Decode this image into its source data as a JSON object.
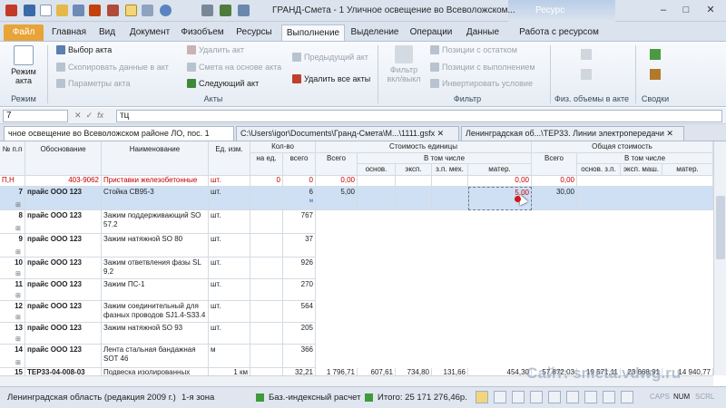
{
  "window": {
    "title": "ГРАНД-Смета - 1 Уличное освещение во Всеволожском...",
    "context_tab": "Ресурс"
  },
  "ribbon_tabs": [
    "Файл",
    "Главная",
    "Вид",
    "Документ",
    "Физобъем",
    "Ресурсы",
    "Выполнение",
    "Выделение",
    "Операции",
    "Данные",
    "Работа с ресурсом"
  ],
  "ribbon": {
    "mode_button": "Режим акта",
    "mode_group": "Режим",
    "select_act": "Выбор акта",
    "copy_data": "Скопировать данные в акт",
    "act_params": "Параметры акта",
    "delete_act": "Удалить акт",
    "smeta_based": "Смета на основе акта",
    "next_act": "Следующий акт",
    "prev_act": "Предыдущий акт",
    "delete_all": "Удалить все акты",
    "acts_group": "Акты",
    "filter_btn": "Фильтр вкл/выкл",
    "pos_remainder": "Позиции с остатком",
    "pos_completed": "Позиции с выполнением",
    "invert": "Инвертировать условие",
    "filter_group": "Фильтр",
    "phys_group": "Физ. объемы в акте",
    "summary_group": "Сводки"
  },
  "formula_bar": {
    "cell_ref": "7",
    "value": "тц"
  },
  "doc_tabs": [
    "чное освещение во Всеволожском районе ЛО, пос. 1",
    "C:\\Users\\igor\\Documents\\Гранд-Смета\\М...\\1111.gsfx",
    "Ленинградская об...\\ТЕР33. Линии электропередачи"
  ],
  "headers": {
    "num": "№ п.п",
    "basis": "Обоснование",
    "name": "Наименование",
    "unit": "Ед. изм.",
    "qty": "Кол-во",
    "qty_per_unit": "на ед.",
    "qty_total": "всего",
    "unit_cost": "Стоимость единицы",
    "total_cost": "Общая стоимость",
    "total": "Всего",
    "incl": "В том числе",
    "base_wage": "основ. з.п.",
    "mach": "эксп. маш.",
    "mach_wage": "з.п. мех.",
    "mat": "матер.",
    "base_wage2": "основ. з.п.",
    "mach2": "эксп. маш.",
    "mat2": "матер."
  },
  "rows": [
    {
      "num": "П,Н",
      "basis": "403-9062",
      "name": "Приставки железобетонные",
      "unit": "шт.",
      "per": "0",
      "total": "0",
      "c_total": "0,00",
      "mat": "0,00",
      "t_total": "0,00"
    },
    {
      "num": "7",
      "basis": "прайс ООО 123",
      "name": "Стойка СВ95-3",
      "unit": "шт.",
      "per": "",
      "total": "6",
      "sub": "м",
      "c_total": "5,00",
      "mat": "5,00",
      "t_total": "30,00"
    },
    {
      "num": "8",
      "basis": "прайс ООО 123",
      "name": "Зажим поддерживающий SO 57.2",
      "unit": "шт.",
      "total": "767"
    },
    {
      "num": "9",
      "basis": "прайс ООО 123",
      "name": "Зажим натяжной SO 80",
      "unit": "шт.",
      "total": "37"
    },
    {
      "num": "10",
      "basis": "прайс ООО 123",
      "name": "Зажим ответвления фазы SL 9.2",
      "unit": "шт.",
      "total": "926"
    },
    {
      "num": "11",
      "basis": "прайс ООО 123",
      "name": "Зажим ПС-1",
      "unit": "шт.",
      "total": "270"
    },
    {
      "num": "12",
      "basis": "прайс ООО 123",
      "name": "Зажим соединительный для фазных проводов  SJ1.4-S33.4",
      "unit": "шт.",
      "total": "564"
    },
    {
      "num": "13",
      "basis": "прайс ООО 123",
      "name": "Зажим натяжной SO 93",
      "unit": "шт.",
      "total": "205"
    },
    {
      "num": "14",
      "basis": "прайс ООО 123",
      "name": "Лента стальная бандажная SOT 46",
      "unit": "м",
      "total": "366"
    },
    {
      "num": "15",
      "basis": "ТЕР33-04-008-03",
      "name": "Подвеска изолированных",
      "unit": "1 км",
      "total": "32,21",
      "c_total": "1 796,71",
      "w": "607,61",
      "m": "734,80",
      "mw": "131,66",
      "mat": "454,30",
      "t_total": "57 872,03",
      "tw": "19 571,11",
      "tm": "23 668,91",
      "tmat": "14 940,77"
    }
  ],
  "status": {
    "region": "Ленинградская область (редакция 2009 г.)",
    "zone": "1-я зона",
    "calc": "Баз.-индексный расчет",
    "total": "Итого: 25 171 276,46р.",
    "caps": "CAPS",
    "num": "NUM",
    "scrl": "SCRL"
  },
  "watermark": "Сайт: smeta.vdwg.ru"
}
